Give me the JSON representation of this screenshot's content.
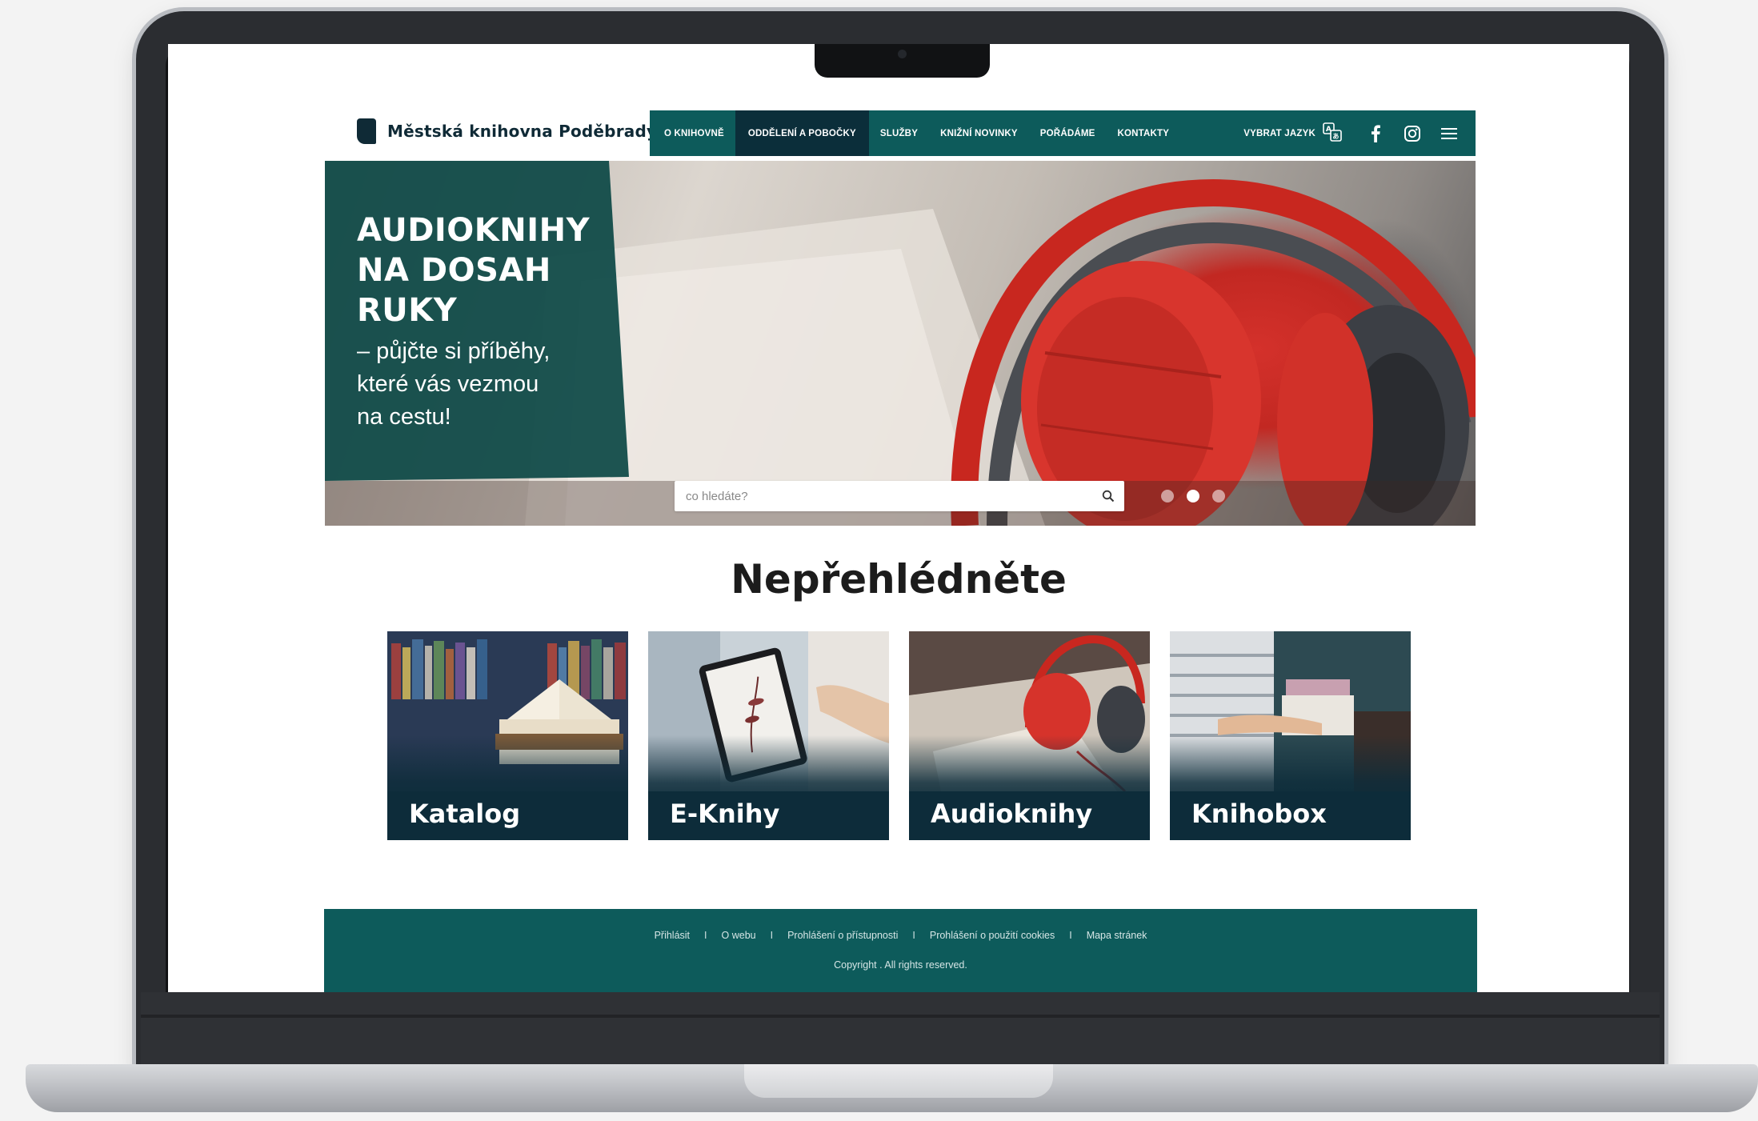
{
  "site": {
    "logo_text": "Městská knihovna Poděbrady"
  },
  "nav": {
    "items": [
      {
        "label": "O KNIHOVNĚ"
      },
      {
        "label": "ODDĚLENÍ A POBOČKY"
      },
      {
        "label": "SLUŽBY"
      },
      {
        "label": "KNIŽNÍ NOVINKY"
      },
      {
        "label": "POŘÁDÁME"
      },
      {
        "label": "KONTAKTY"
      }
    ],
    "active_index": 1,
    "language_label": "VYBRAT JAZYK",
    "icons": [
      "translate-icon",
      "facebook-icon",
      "instagram-icon",
      "menu-icon"
    ]
  },
  "hero": {
    "title": "AUDIOKNIHY\nNA DOSAH\nRUKY",
    "subtitle": "– půjčte si příběhy,\nkteré vás vezmou\nna cestu!",
    "search_placeholder": "co hledáte?",
    "slides_count": 3,
    "active_slide": 1
  },
  "section": {
    "title": "Nepřehlédněte"
  },
  "cards": [
    {
      "label": "Katalog"
    },
    {
      "label": "E-Knihy"
    },
    {
      "label": "Audioknihy"
    },
    {
      "label": "Knihobox"
    }
  ],
  "footer": {
    "links": [
      {
        "label": "Přihlásit"
      },
      {
        "label": "O webu"
      },
      {
        "label": "Prohlášení o přístupnosti"
      },
      {
        "label": "Prohlášení o použití cookies"
      },
      {
        "label": "Mapa stránek"
      }
    ],
    "separator": "I",
    "copyright": "Copyright . All rights reserved."
  },
  "colors": {
    "primary_teal": "#0d5b5b",
    "dark_navy": "#0d2c3a",
    "accent_red": "#d4312b"
  }
}
